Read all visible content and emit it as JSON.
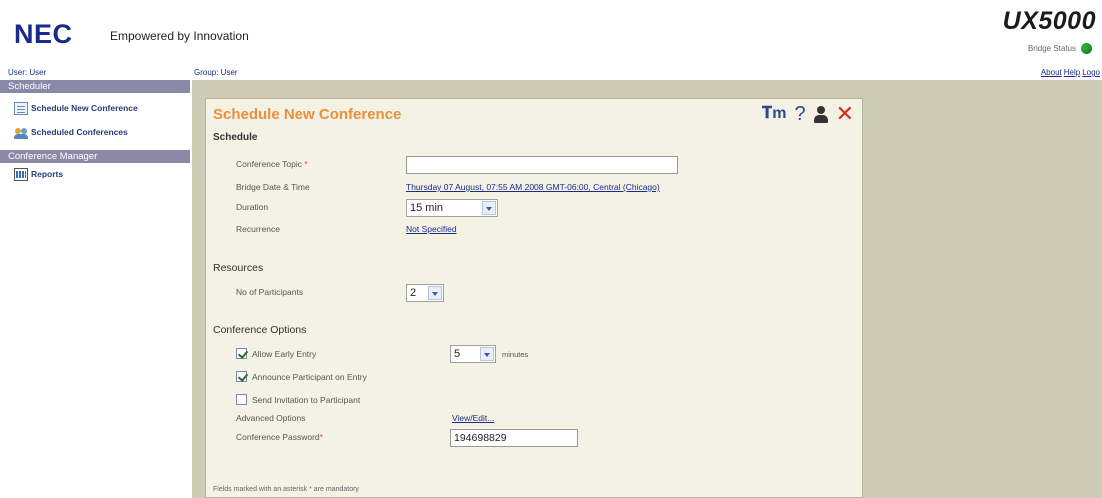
{
  "header": {
    "logo": "NEC",
    "tagline": "Empowered by Innovation",
    "product": "UX5000",
    "bridge_status_label": "Bridge Status"
  },
  "infobar": {
    "user": "User: User",
    "group": "Group: User",
    "links": [
      "About",
      "Help",
      "Logo"
    ]
  },
  "sidebar": {
    "scheduler_header": "Scheduler",
    "scheduler_items": [
      {
        "label": "Schedule New Conference",
        "icon": "document-icon"
      },
      {
        "label": "Scheduled Conferences",
        "icon": "people-icon"
      }
    ],
    "manager_header": "Conference Manager",
    "manager_items": [
      {
        "label": "Reports",
        "icon": "report-icon"
      }
    ]
  },
  "panel": {
    "title": "Schedule New Conference",
    "schedule_section": "Schedule",
    "topic_label": "Conference Topic",
    "topic_value": "",
    "bridge_date_label": "Bridge Date & Time",
    "bridge_date_value": "Thursday 07 August, 07:55 AM 2008 GMT-06:00, Central (Chicago)",
    "duration_label": "Duration",
    "duration_value": "15 min",
    "recurrence_label": "Recurrence",
    "recurrence_value": "Not Specified",
    "resources_section": "Resources",
    "participants_label": "No of Participants",
    "participants_value": "2",
    "options_section": "Conference Options",
    "allow_early_label": "Allow Early Entry",
    "allow_early_checked": true,
    "early_minutes_value": "5",
    "minutes_label": "minutes",
    "announce_label": "Announce Participant on Entry",
    "announce_checked": true,
    "invite_label": "Send Invitation to Participant",
    "invite_checked": false,
    "advanced_label": "Advanced Options",
    "advanced_link": "View/Edit...",
    "password_label": "Conference Password",
    "password_value": "194698829",
    "footnote_pre": "Fields marked with an asterisk",
    "footnote_post": "are mandatory"
  },
  "colors": {
    "title_orange": "#e8903a",
    "main_bg": "#cfcbb5",
    "panel_bg": "#f4f2e4",
    "sidebar_header": "#8a8aa8",
    "status_green": "#2aa83c",
    "close_red": "#d42a1a"
  }
}
